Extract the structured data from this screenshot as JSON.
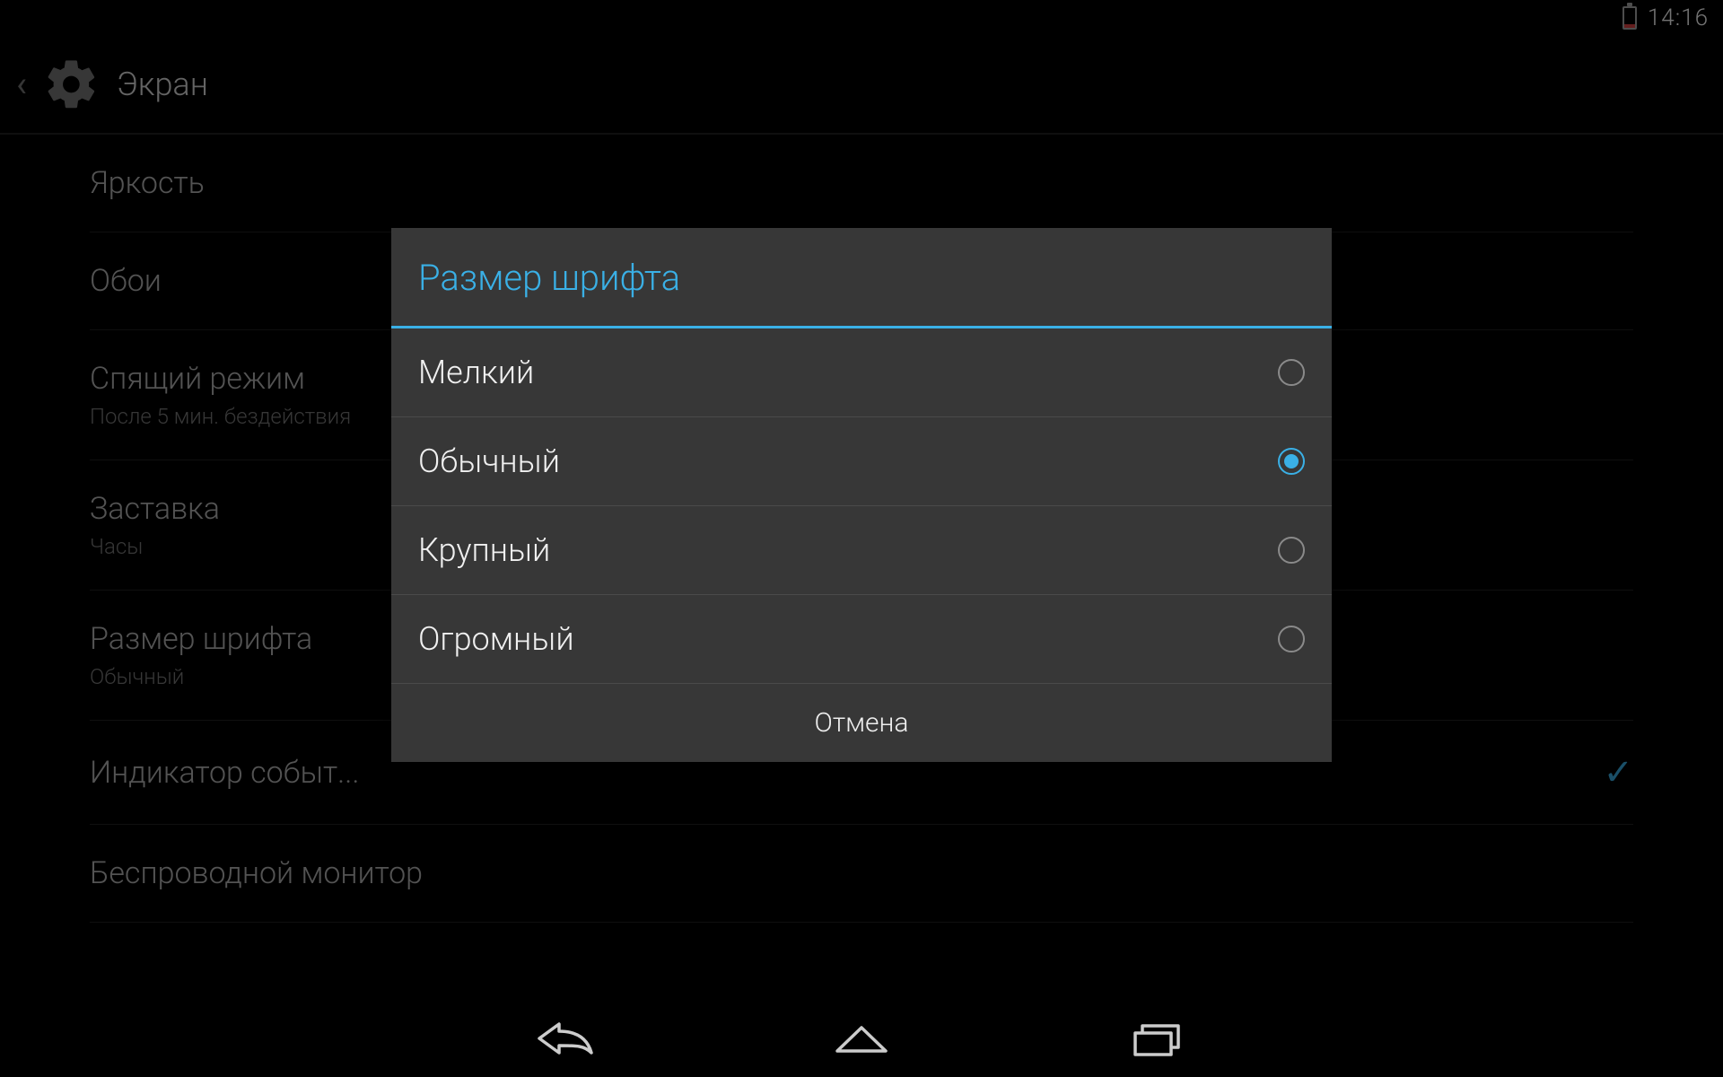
{
  "status": {
    "time": "14:16"
  },
  "actionbar": {
    "title": "Экран"
  },
  "settings": {
    "items": [
      {
        "title": "Яркость",
        "subtitle": null,
        "checkbox": false
      },
      {
        "title": "Обои",
        "subtitle": null,
        "checkbox": false
      },
      {
        "title": "Спящий режим",
        "subtitle": "После 5 мин. бездействия",
        "checkbox": false
      },
      {
        "title": "Заставка",
        "subtitle": "Часы",
        "checkbox": false
      },
      {
        "title": "Размер шрифта",
        "subtitle": "Обычный",
        "checkbox": false
      },
      {
        "title": "Индикатор событ...",
        "subtitle": null,
        "checkbox": true
      },
      {
        "title": "Беспроводной монитор",
        "subtitle": null,
        "checkbox": false
      }
    ]
  },
  "dialog": {
    "title": "Размер шрифта",
    "options": [
      {
        "label": "Мелкий",
        "selected": false
      },
      {
        "label": "Обычный",
        "selected": true
      },
      {
        "label": "Крупный",
        "selected": false
      },
      {
        "label": "Огромный",
        "selected": false
      }
    ],
    "cancel_label": "Отмена"
  },
  "colors": {
    "accent": "#3ab0e6"
  }
}
